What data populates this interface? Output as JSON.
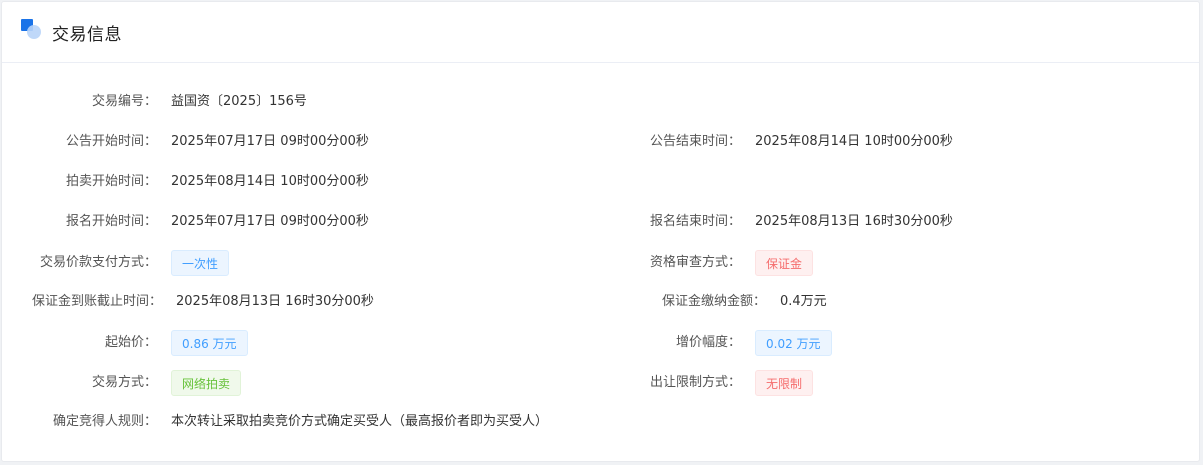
{
  "header": {
    "title": "交易信息",
    "icon": "info-section-icon"
  },
  "rows": {
    "trade_no": {
      "label": "交易编号：",
      "value": "益国资〔2025〕156号"
    },
    "notice_start": {
      "label": "公告开始时间：",
      "value": "2025年07月17日 09时00分00秒"
    },
    "notice_end": {
      "label": "公告结束时间：",
      "value": "2025年08月14日 10时00分00秒"
    },
    "auction_start": {
      "label": "拍卖开始时间：",
      "value": "2025年08月14日 10时00分00秒"
    },
    "signup_start": {
      "label": "报名开始时间：",
      "value": "2025年07月17日 09时00分00秒"
    },
    "signup_end": {
      "label": "报名结束时间：",
      "value": "2025年08月13日 16时30分00秒"
    },
    "payment_method": {
      "label": "交易价款支付方式：",
      "value": "一次性"
    },
    "qualification_method": {
      "label": "资格审查方式：",
      "value": "保证金"
    },
    "deposit_deadline": {
      "label": "保证金到账截止时间：",
      "value": "2025年08月13日 16时30分00秒"
    },
    "deposit_amount": {
      "label": "保证金缴纳金额：",
      "value": "0.4万元"
    },
    "start_price": {
      "label": "起始价：",
      "value": "0.86 万元"
    },
    "price_increment": {
      "label": "增价幅度：",
      "value": "0.02 万元"
    },
    "trade_method": {
      "label": "交易方式：",
      "value": "网络拍卖"
    },
    "transfer_restriction": {
      "label": "出让限制方式：",
      "value": "无限制"
    },
    "winner_rule": {
      "label": "确定竞得人规则：",
      "value": "本次转让采取拍卖竞价方式确定买受人（最高报价者即为买受人）"
    }
  },
  "colors": {
    "accent": "#1a73e8",
    "tag_blue": "#409eff",
    "tag_red": "#f56c6c",
    "tag_green": "#67c23a"
  }
}
